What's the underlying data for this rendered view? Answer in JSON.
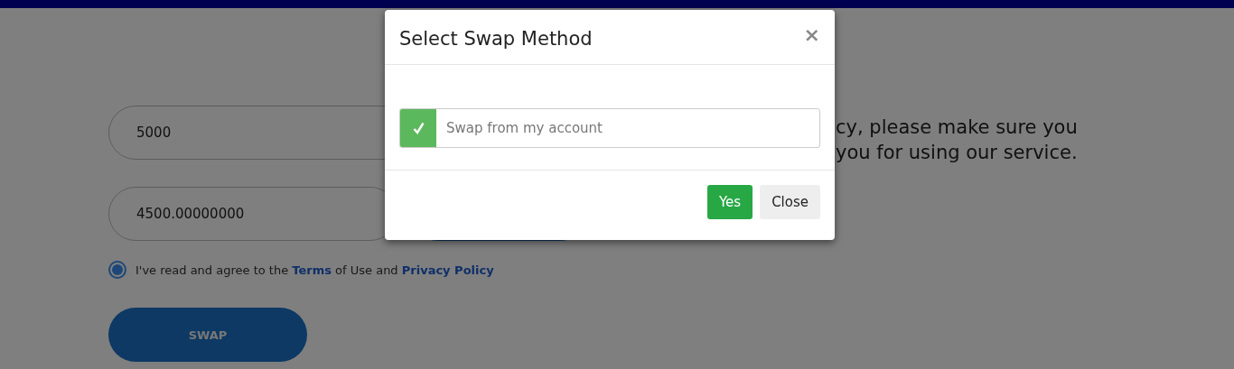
{
  "form": {
    "amount_field": {
      "value": "5000"
    },
    "received_field": {
      "value": "4500.00000000"
    },
    "agreement": {
      "checked": true,
      "text_before": "I've read and agree to the ",
      "terms_link": "Terms",
      "text_middle": " of Use and ",
      "privacy_link": "Privacy Policy"
    },
    "swap_button": "SWAP"
  },
  "notice": {
    "lines": [
      "cy, please make sure you",
      "you for using our service."
    ]
  },
  "modal": {
    "title": "Select Swap Method",
    "close_icon": "×",
    "options": [
      {
        "label": "Swap from my account",
        "selected": true
      }
    ],
    "buttons": [
      {
        "kind": "primary",
        "label": "Yes"
      },
      {
        "kind": "secondary",
        "label": "Close"
      }
    ]
  }
}
